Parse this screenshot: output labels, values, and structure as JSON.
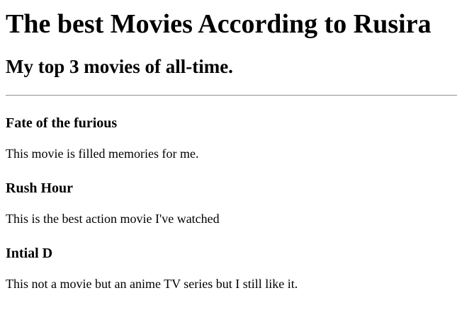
{
  "page": {
    "title": "The best Movies According to Rusira",
    "subtitle": "My top 3 movies of all-time."
  },
  "movies": [
    {
      "title": "Fate of the furious",
      "description": "This movie is filled memories for me."
    },
    {
      "title": "Rush Hour",
      "description": "This is the best action movie I've watched"
    },
    {
      "title": "Intial D",
      "description": "This not a movie but an anime TV series but I still like it."
    }
  ],
  "colors": {
    "background": "#ffffff",
    "text": "#000000",
    "divider": "#9a9a9a"
  }
}
